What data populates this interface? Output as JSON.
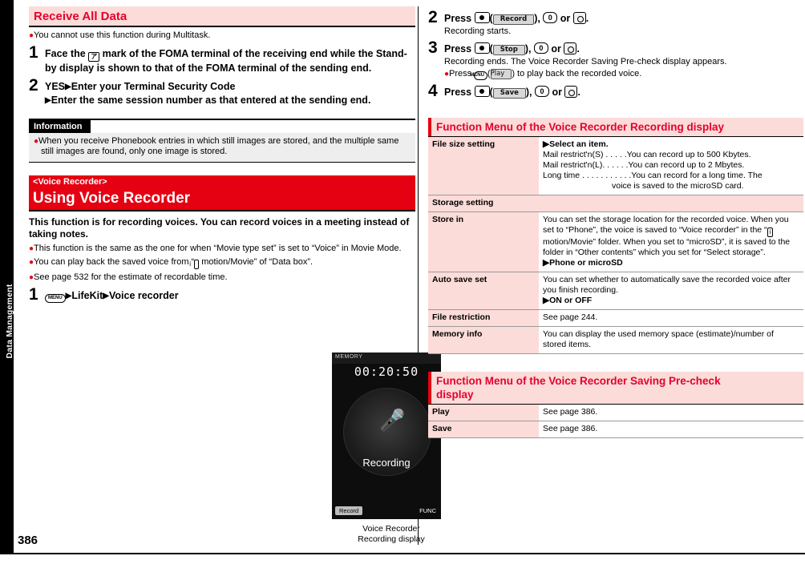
{
  "side_tab": "Data Management",
  "page_number": "386",
  "left": {
    "section1_title": "Receive All Data",
    "bullets1": [
      "You cannot use this function during Multitask."
    ],
    "step1_num": "1",
    "step1_text": "Face the      mark of the FOMA terminal of the receiving end while the Stand-by display is shown to that of the FOMA terminal of the sending end.",
    "step2_num": "2",
    "step2_line1": "YES",
    "step2_line1b": "Enter your Terminal Security Code",
    "step2_line2": "Enter the same session number as that entered at the sending end.",
    "information_label": "Information",
    "information_text": "When you receive Phonebook entries in which still images are stored, and the multiple same still images are found, only one image is stored.",
    "section2_tag": "<Voice Recorder>",
    "section2_title": "Using Voice Recorder",
    "intro": "This function is for recording voices. You can record voices in a meeting instead of taking notes.",
    "bullets2": [
      "This function is the same as the one for when “Movie type set” is set to “Voice” in Movie Mode.",
      "You can play back the saved voice from “    motion/Movie” of “Data box”.",
      "See page 532 for the estimate of recordable time."
    ],
    "step_m_num": "1",
    "step_m_menu": "LifeKit",
    "step_m_item": "Voice recorder",
    "phone": {
      "status_left": "MEMORY",
      "time": "00:20:50",
      "label": "Recording",
      "softkey_left": "Record",
      "softkey_right": "FUNC"
    },
    "phone_caption_line1": "Voice Recorder",
    "phone_caption_line2": "Recording display"
  },
  "right": {
    "step2_num": "2",
    "step2_press": "Press",
    "step2_soft": "Record",
    "step2_tail": ", ",
    "step2_or": "or",
    "step2_sub": "Recording starts.",
    "step3_num": "3",
    "step3_press": "Press",
    "step3_soft": "Stop",
    "step3_or": "or",
    "step3_sub": "Recording ends. The Voice Recorder Saving Pre-check display appears.",
    "step3_bullet_pre": "Press",
    "step3_bullet_soft": "Play",
    "step3_bullet_post": "to play back the recorded voice.",
    "step4_num": "4",
    "step4_press": "Press",
    "step4_soft": "Save",
    "step4_or": "or",
    "fn1_title": "Function Menu of the Voice Recorder Recording display",
    "fn1_rows": [
      {
        "key": "File size setting",
        "indent": false,
        "value_lines": [
          "▶Select an item.",
          "Mail restrict'n(S)  . . . . .You can record up to 500 Kbytes.",
          "Mail restrict'n(L). . . . . .You can record up to 2 Mbytes.",
          "Long time . . . . . . . . . . .You can record for a long time. The",
          "voice is saved to the microSD card."
        ]
      }
    ],
    "fn1_storage_header": "Storage setting",
    "fn1_storage_rows": [
      {
        "key": "Store in",
        "value": "You can set the storage location for the recorded voice. When you set to “Phone”, the voice is saved to “Voice recorder” in the “    motion/Movie” folder. When you set to “microSD”, it is saved to the folder in “Other contents” which you set for “Select storage”.",
        "value2": "▶Phone or microSD"
      },
      {
        "key": "Auto save set",
        "value": "You can set whether to automatically save the recorded voice after you finish recording.",
        "value2": "▶ON or OFF"
      },
      {
        "key": "File restriction",
        "value": "See page 244.",
        "value2": ""
      }
    ],
    "fn1_memory": {
      "key": "Memory info",
      "value": "You can display the used memory space (estimate)/number of stored items."
    },
    "fn2_title_line1": "Function Menu of the Voice Recorder Saving Pre-check",
    "fn2_title_line2": "display",
    "fn2_rows": [
      {
        "key": "Play",
        "value": "See page 386."
      },
      {
        "key": "Save",
        "value": "See page 386."
      }
    ]
  }
}
